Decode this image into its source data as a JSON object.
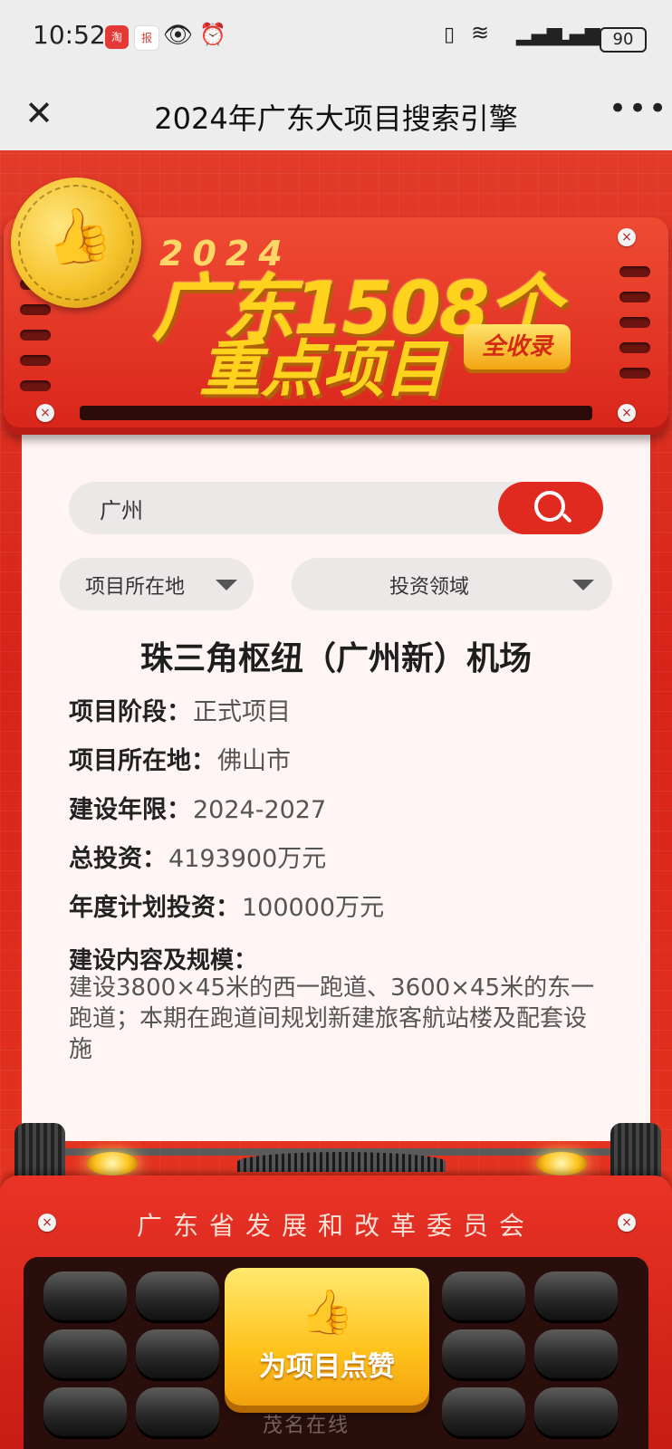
{
  "status_bar": {
    "time": "10:52",
    "battery": "90",
    "icons": [
      "vibrate-icon",
      "wifi-icon",
      "signal-icon",
      "signal-icon-2"
    ]
  },
  "nav": {
    "title": "2024年广东大项目搜索引擎",
    "close_icon": "close-icon",
    "more_icon": "more-icon"
  },
  "banner": {
    "year": "2024",
    "line1": "广东1508个",
    "line2": "重点项目",
    "badge": "全收录"
  },
  "search": {
    "value": "广州"
  },
  "filters": {
    "location": "项目所在地",
    "field": "投资领域"
  },
  "project": {
    "title": "珠三角枢纽（广州新）机场",
    "stage_label": "项目阶段：",
    "stage_value": "正式项目",
    "location_label": "项目所在地：",
    "location_value": "佛山市",
    "period_label": "建设年限：",
    "period_value": "2024-2027",
    "total_label": "总投资：",
    "total_value": "4193900万元",
    "annual_label": "年度计划投资：",
    "annual_value": "100000万元",
    "scope_label": "建设内容及规模：",
    "scope_text": "建设3800×45米的西一跑道、3600×45米的东一跑道；本期在跑道间规划新建旅客航站楼及配套设施"
  },
  "footer": {
    "org": "广东省发展和改革委员会",
    "like_button": "为项目点赞",
    "watermark": "茂名在线"
  },
  "colors": {
    "brand_red": "#d9261c",
    "gold": "#ffd21e",
    "paper": "#fff5f4"
  }
}
